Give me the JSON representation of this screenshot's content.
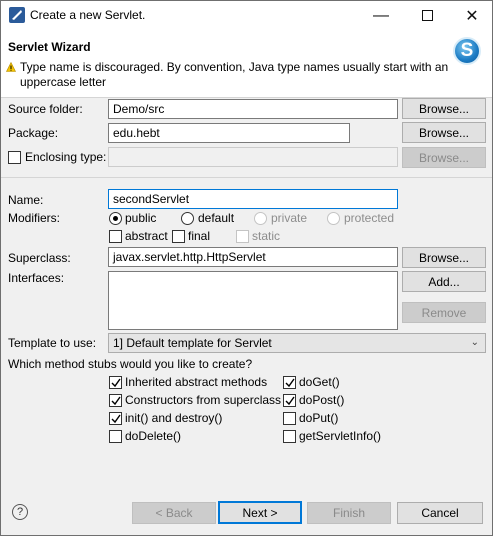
{
  "window": {
    "title": "Create a new Servlet."
  },
  "header": {
    "title": "Servlet Wizard",
    "warning": "Type name is discouraged. By convention, Java type names usually start with an uppercase letter",
    "logo_letter": "S"
  },
  "form": {
    "source_folder": {
      "label": "Source folder:",
      "value": "Demo/src",
      "browse": "Browse..."
    },
    "package": {
      "label": "Package:",
      "value": "edu.hebt",
      "browse": "Browse..."
    },
    "enclosing_type": {
      "label": "Enclosing type:",
      "value": "",
      "browse": "Browse..."
    },
    "name": {
      "label": "Name:",
      "value": "secondServlet"
    },
    "modifiers": {
      "label": "Modifiers:",
      "radios": [
        "public",
        "default",
        "private",
        "protected"
      ],
      "selected": "public",
      "checks": [
        "abstract",
        "final",
        "static"
      ]
    },
    "superclass": {
      "label": "Superclass:",
      "value": "javax.servlet.http.HttpServlet",
      "browse": "Browse..."
    },
    "interfaces": {
      "label": "Interfaces:",
      "add": "Add...",
      "remove": "Remove"
    },
    "template": {
      "label": "Template to use:",
      "value": "1] Default template for Servlet"
    },
    "stubs": {
      "question": "Which method stubs would you like to create?",
      "items": [
        {
          "label": "Inherited abstract methods",
          "checked": true
        },
        {
          "label": "doGet()",
          "checked": true
        },
        {
          "label": "Constructors from superclass",
          "checked": true
        },
        {
          "label": "doPost()",
          "checked": true
        },
        {
          "label": "init() and destroy()",
          "checked": true
        },
        {
          "label": "doPut()",
          "checked": false
        },
        {
          "label": "doDelete()",
          "checked": false
        },
        {
          "label": "getServletInfo()",
          "checked": false
        }
      ]
    }
  },
  "footer": {
    "help": "?",
    "back": "< Back",
    "next": "Next >",
    "finish": "Finish",
    "cancel": "Cancel"
  }
}
